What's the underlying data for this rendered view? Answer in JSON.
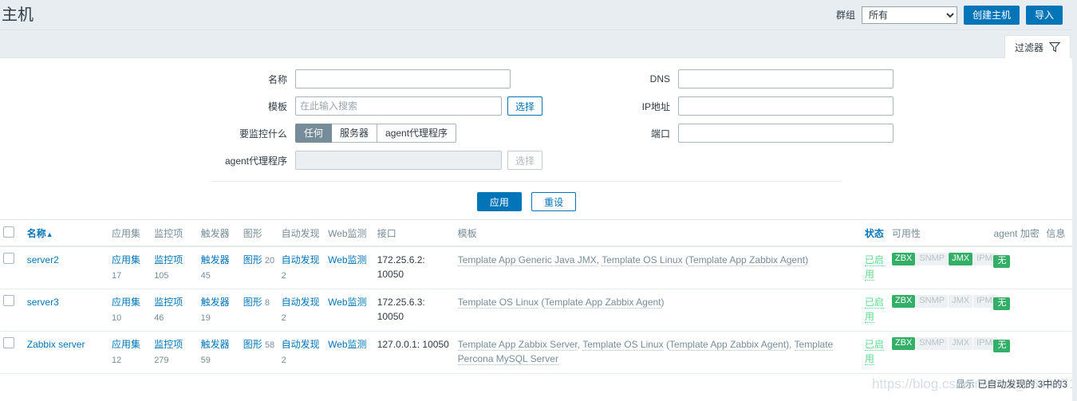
{
  "header": {
    "title": "主机",
    "group_label": "群组",
    "group_value": "所有",
    "create_host_label": "创建主机",
    "import_label": "导入"
  },
  "filter_tab": {
    "label": "过滤器",
    "icon": "funnel-icon"
  },
  "filter": {
    "name_label": "名称",
    "name_value": "",
    "template_label": "模板",
    "template_placeholder": "在此输入搜索",
    "template_select_label": "选择",
    "monitored_by_label": "要监控什么",
    "monitored_by_options": [
      "任何",
      "服务器",
      "agent代理程序"
    ],
    "monitored_by_selected": "任何",
    "proxy_label": "agent代理程序",
    "proxy_value": "",
    "proxy_select_label": "选择",
    "dns_label": "DNS",
    "dns_value": "",
    "ip_label": "IP地址",
    "ip_value": "",
    "port_label": "端口",
    "port_value": "",
    "apply_label": "应用",
    "reset_label": "重设"
  },
  "table": {
    "columns": {
      "name": "名称",
      "sort_arrow": "▲",
      "applications": "应用集",
      "items": "监控项",
      "triggers": "触发器",
      "graphs": "图形",
      "discovery": "自动发现",
      "web": "Web监测",
      "interface": "接口",
      "templates": "模板",
      "status": "状态",
      "availability": "可用性",
      "encryption": "agent 加密",
      "info": "信息"
    },
    "rows": [
      {
        "name": "server2",
        "applications_label": "应用集",
        "applications_count": "17",
        "items_label": "监控项",
        "items_count": "105",
        "triggers_label": "触发器",
        "triggers_count": "45",
        "graphs_label": "图形",
        "graphs_count": "20",
        "discovery_label": "自动发现",
        "discovery_count": "2",
        "web_label": "Web监测",
        "interface": "172.25.6.2: 10050",
        "templates": [
          {
            "text": "Template App Generic Java JMX",
            "link": true
          },
          {
            "text": ", ",
            "link": false
          },
          {
            "text": "Template OS Linux",
            "link": true
          },
          {
            "text": " (",
            "link": false
          },
          {
            "text": "Template App Zabbix Agent",
            "link": true
          },
          {
            "text": ")",
            "link": false
          }
        ],
        "status": "已启用",
        "availability": [
          {
            "label": "ZBX",
            "active": true
          },
          {
            "label": "SNMP",
            "active": false
          },
          {
            "label": "JMX",
            "active": true
          },
          {
            "label": "IPMI",
            "active": false
          }
        ],
        "encryption": "无",
        "info": ""
      },
      {
        "name": "server3",
        "applications_label": "应用集",
        "applications_count": "10",
        "items_label": "监控项",
        "items_count": "46",
        "triggers_label": "触发器",
        "triggers_count": "19",
        "graphs_label": "图形",
        "graphs_count": "8",
        "discovery_label": "自动发现",
        "discovery_count": "2",
        "web_label": "Web监测",
        "interface": "172.25.6.3: 10050",
        "templates": [
          {
            "text": "Template OS Linux",
            "link": true
          },
          {
            "text": " (",
            "link": false
          },
          {
            "text": "Template App Zabbix Agent",
            "link": true
          },
          {
            "text": ")",
            "link": false
          }
        ],
        "status": "已启用",
        "availability": [
          {
            "label": "ZBX",
            "active": true
          },
          {
            "label": "SNMP",
            "active": false
          },
          {
            "label": "JMX",
            "active": false
          },
          {
            "label": "IPMI",
            "active": false
          }
        ],
        "encryption": "无",
        "info": ""
      },
      {
        "name": "Zabbix server",
        "applications_label": "应用集",
        "applications_count": "12",
        "items_label": "监控项",
        "items_count": "279",
        "triggers_label": "触发器",
        "triggers_count": "59",
        "graphs_label": "图形",
        "graphs_count": "58",
        "discovery_label": "自动发现",
        "discovery_count": "2",
        "web_label": "Web监测",
        "interface": "127.0.0.1: 10050",
        "templates": [
          {
            "text": "Template App Zabbix Server",
            "link": true
          },
          {
            "text": ", ",
            "link": false
          },
          {
            "text": "Template OS Linux",
            "link": true
          },
          {
            "text": " (",
            "link": false
          },
          {
            "text": "Template App Zabbix Agent",
            "link": true
          },
          {
            "text": "), ",
            "link": false
          },
          {
            "text": "Template Percona MySQL Server",
            "link": true
          }
        ],
        "status": "已启用",
        "availability": [
          {
            "label": "ZBX",
            "active": true
          },
          {
            "label": "SNMP",
            "active": false
          },
          {
            "label": "JMX",
            "active": false
          },
          {
            "label": "IPMI",
            "active": false
          }
        ],
        "encryption": "无",
        "info": ""
      }
    ]
  },
  "footer": {
    "showing_prefix": "显示",
    "showing_text": "已自动发现的 3中的3"
  },
  "watermark": "https://blog.csdn.net/mo_664447160",
  "colors": {
    "accent": "#0275b8",
    "header_bg": "#e8edf1",
    "green": "#34af67",
    "muted": "#768d99"
  }
}
